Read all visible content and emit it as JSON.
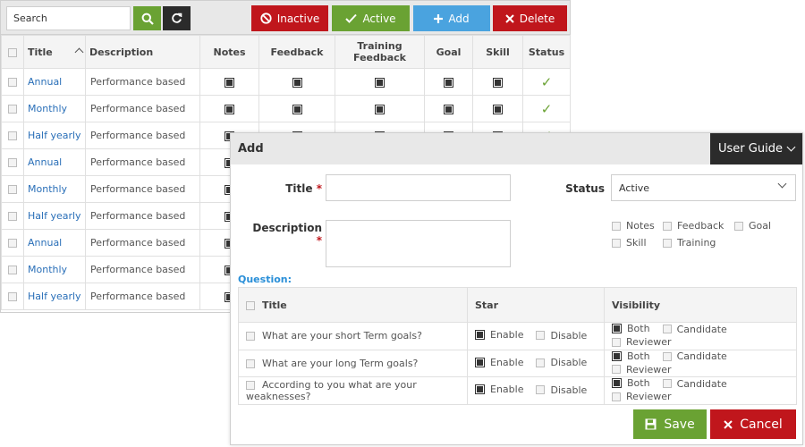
{
  "toolbar": {
    "search_placeholder": "Search",
    "inactive_label": "Inactive",
    "active_label": "Active",
    "add_label": "Add",
    "delete_label": "Delete"
  },
  "list": {
    "columns": [
      "Title",
      "Description",
      "Notes",
      "Feedback",
      "Training Feedback",
      "Goal",
      "Skill",
      "Status"
    ],
    "rows": [
      {
        "title": "Annual",
        "description": "Performance based"
      },
      {
        "title": "Monthly",
        "description": "Performance based"
      },
      {
        "title": "Half yearly",
        "description": "Performance based"
      },
      {
        "title": "Annual",
        "description": "Performance based"
      },
      {
        "title": "Monthly",
        "description": "Performance based"
      },
      {
        "title": "Half yearly",
        "description": "Performance based"
      },
      {
        "title": "Annual",
        "description": "Performance based"
      },
      {
        "title": "Monthly",
        "description": "Performance based"
      },
      {
        "title": "Half yearly",
        "description": "Performance based"
      }
    ]
  },
  "modal": {
    "title": "Add",
    "user_guide_label": "User Guide",
    "title_label": "Title",
    "description_label": "Description",
    "required_mark": "*",
    "status_label": "Status",
    "status_value": "Active",
    "visibility_options": [
      "Notes",
      "Feedback",
      "Goal",
      "Skill",
      "Training"
    ],
    "question_label": "Question:",
    "question_columns": [
      "Title",
      "Star",
      "Visibility"
    ],
    "questions": [
      {
        "text": "What are your short Term goals?"
      },
      {
        "text": "What are your long Term goals?"
      },
      {
        "text": "According to you what are your weaknesses?"
      }
    ],
    "star_options": [
      "Enable",
      "Disable"
    ],
    "visibility_roles": [
      "Both",
      "Candidate",
      "Reviewer"
    ],
    "save_label": "Save",
    "cancel_label": "Cancel"
  },
  "colors": {
    "green": "#6aa233",
    "red": "#c0161c",
    "blue": "#4aa3df",
    "dark": "#2b2b2b",
    "link": "#2a6fb8"
  }
}
